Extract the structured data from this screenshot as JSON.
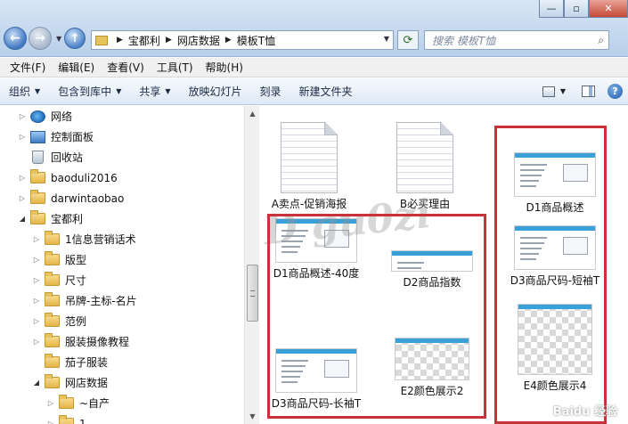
{
  "window": {
    "minimize": "—",
    "maximize": "▫",
    "close": "✕"
  },
  "address": {
    "crumbs": [
      "宝都利",
      "网店数据",
      "模板T恤"
    ]
  },
  "search": {
    "placeholder": "搜索 模板T恤"
  },
  "menu": [
    "文件(F)",
    "编辑(E)",
    "查看(V)",
    "工具(T)",
    "帮助(H)"
  ],
  "toolbar": {
    "items": [
      {
        "label": "组织",
        "dropdown": true
      },
      {
        "label": "包含到库中",
        "dropdown": true
      },
      {
        "label": "共享",
        "dropdown": true
      },
      {
        "label": "放映幻灯片",
        "dropdown": false
      },
      {
        "label": "刻录",
        "dropdown": false
      },
      {
        "label": "新建文件夹",
        "dropdown": false
      }
    ]
  },
  "tree": [
    {
      "label": "网络",
      "icon": "network-icon",
      "expander": "collapsed",
      "indent": 0
    },
    {
      "label": "控制面板",
      "icon": "control-panel-icon",
      "expander": "collapsed",
      "indent": 0
    },
    {
      "label": "回收站",
      "icon": "recycle-bin-icon",
      "expander": "none",
      "indent": 0
    },
    {
      "label": "baoduli2016",
      "icon": "folder-icon",
      "expander": "collapsed",
      "indent": 0
    },
    {
      "label": "darwintaobao",
      "icon": "folder-icon",
      "expander": "collapsed",
      "indent": 0
    },
    {
      "label": "宝都利",
      "icon": "folder-icon",
      "expander": "expanded",
      "indent": 0
    },
    {
      "label": "1信息营销话术",
      "icon": "folder-icon",
      "expander": "collapsed",
      "indent": 1
    },
    {
      "label": "版型",
      "icon": "folder-icon",
      "expander": "collapsed",
      "indent": 1
    },
    {
      "label": "尺寸",
      "icon": "folder-icon",
      "expander": "collapsed",
      "indent": 1
    },
    {
      "label": "吊牌-主标-名片",
      "icon": "folder-icon",
      "expander": "collapsed",
      "indent": 1
    },
    {
      "label": "范例",
      "icon": "folder-icon",
      "expander": "collapsed",
      "indent": 1
    },
    {
      "label": "服装摄像教程",
      "icon": "folder-icon",
      "expander": "collapsed",
      "indent": 1
    },
    {
      "label": "茄子服装",
      "icon": "folder-icon",
      "expander": "none",
      "indent": 1
    },
    {
      "label": "网店数据",
      "icon": "folder-icon",
      "expander": "expanded",
      "indent": 1
    },
    {
      "label": "~自产",
      "icon": "folder-icon",
      "expander": "collapsed",
      "indent": 2
    },
    {
      "label": "1",
      "icon": "folder-icon",
      "expander": "collapsed",
      "indent": 2
    }
  ],
  "files": [
    {
      "label": "A卖点-促销海报",
      "thumb": "doc"
    },
    {
      "label": "B必买理由",
      "thumb": "doc"
    },
    {
      "label": "D1商品概述",
      "thumb": "shot"
    },
    {
      "label": "D1商品概述-40度",
      "thumb": "shot"
    },
    {
      "label": "D2商品指数",
      "thumb": "shot-strip"
    },
    {
      "label": "D3商品尺码-短袖T",
      "thumb": "shot"
    },
    {
      "label": "D3商品尺码-长袖T",
      "thumb": "shot"
    },
    {
      "label": "E2颜色展示2",
      "thumb": "checker"
    },
    {
      "label": "E4颜色展示4",
      "thumb": "checker-tall"
    }
  ],
  "watermarks": {
    "main": "百度 D gu0zi",
    "corner": "Baidu 经验"
  },
  "highlight_color": "#c8323a"
}
